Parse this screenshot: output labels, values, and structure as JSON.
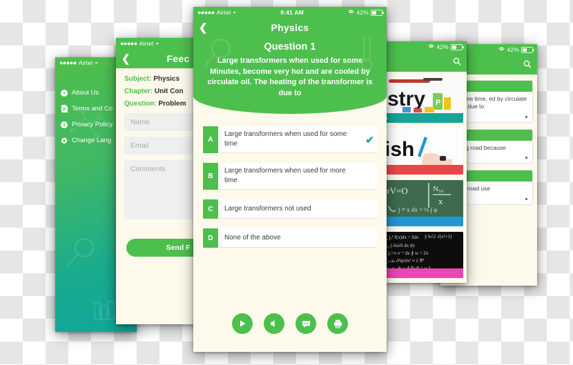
{
  "statusbar": {
    "dots": "●●●●●",
    "carrier": "Airtel",
    "wifi_icon": "wifi-icon",
    "time": "9:41 AM",
    "bluetooth_icon": "bluetooth-icon",
    "battery": "42%"
  },
  "settings_panel": {
    "items": [
      {
        "label": "About Us",
        "icon": "help-circle-icon",
        "glyph": "?"
      },
      {
        "label": "Terms and Co",
        "icon": "document-icon",
        "glyph": "▤"
      },
      {
        "label": "Privacy Policy",
        "icon": "info-circle-icon",
        "glyph": "i"
      },
      {
        "label": "Change Lang",
        "icon": "gear-icon",
        "glyph": "✿"
      }
    ]
  },
  "feedback_panel": {
    "nav_title": "Feec",
    "back_icon": "chevron-left-icon",
    "rows": [
      {
        "key": "Subject:",
        "value": "Physics"
      },
      {
        "key": "Chapter:",
        "value": "Unit Con"
      },
      {
        "key": "Question:",
        "value": "Problem"
      }
    ],
    "fields": [
      {
        "name": "name-input",
        "placeholder": "Name"
      },
      {
        "name": "email-input",
        "placeholder": "Email"
      },
      {
        "name": "comments-input",
        "placeholder": "Comments"
      }
    ],
    "send_label": "Send F"
  },
  "main_panel": {
    "nav_title": "Physics",
    "back_icon": "chevron-left-icon",
    "question_title": "Question 1",
    "question_text": "Large transformers when used for some Minutes, become very hot and are cooled by circulate oil. The heating of the transformer is due to",
    "options": [
      {
        "letter": "A",
        "text": "Large transformers when used for some time",
        "selected": true
      },
      {
        "letter": "B",
        "text": "Large transformers when used for more time",
        "selected": false
      },
      {
        "letter": "C",
        "text": "Large transformers not used",
        "selected": false
      },
      {
        "letter": "D",
        "text": "None of the above",
        "selected": false
      }
    ],
    "check_glyph": "✔",
    "toolbar": [
      {
        "name": "play-button",
        "icon": "play-icon"
      },
      {
        "name": "mute-button",
        "icon": "volume-off-icon"
      },
      {
        "name": "chat-button",
        "icon": "chat-bubble-icon"
      },
      {
        "name": "print-button",
        "icon": "printer-icon"
      }
    ]
  },
  "subjects_panel": {
    "search_icon": "search-icon",
    "cards": [
      {
        "label": "y",
        "image": "chemistry-book-photo",
        "bar_color": "#17a398"
      },
      {
        "label": "",
        "image": "english-handwriting-photo",
        "bar_color": "#e8474a"
      },
      {
        "label": "",
        "image": "green-chalkboard-formula-photo",
        "bar_color": "#2196d4"
      },
      {
        "label": "",
        "image": "black-chalkboard-math-photo",
        "bar_color": "#ee46b0"
      }
    ]
  },
  "qlist_panel": {
    "search_icon": "search-icon",
    "cards": [
      {
        "text": "for some time, ed by circulate mer is due to"
      },
      {
        "text": "sloping road because"
      },
      {
        "text": "sandy road use"
      }
    ]
  },
  "colors": {
    "brand_green": "#4dbf4d",
    "teal": "#0fa79c",
    "cream": "#fdfaec",
    "check": "#1aab8e"
  }
}
